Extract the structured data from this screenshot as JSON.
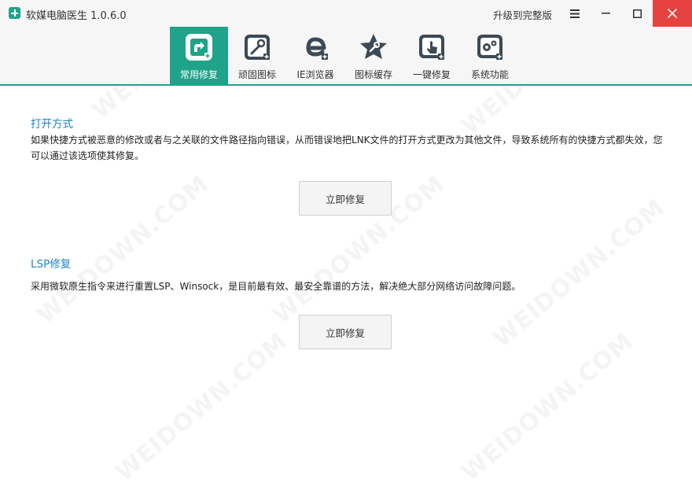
{
  "window": {
    "title": "软媒电脑医生 1.0.6.0",
    "upgrade_label": "升级到完整版"
  },
  "toolbar": {
    "tabs": [
      {
        "label": "常用修复",
        "icon": "common-repair-icon",
        "active": true
      },
      {
        "label": "顽固图标",
        "icon": "stubborn-icon-tools-icon",
        "active": false
      },
      {
        "label": "IE浏览器",
        "icon": "ie-browser-icon",
        "active": false
      },
      {
        "label": "图标缓存",
        "icon": "icon-cache-star-icon",
        "active": false
      },
      {
        "label": "一键修复",
        "icon": "one-click-repair-icon",
        "active": false
      },
      {
        "label": "系统功能",
        "icon": "system-functions-gear-icon",
        "active": false
      }
    ]
  },
  "sections": [
    {
      "title": "打开方式",
      "description": "如果快捷方式被恶意的修改或者与之关联的文件路径指向错误，从而错误地把LNK文件的打开方式更改为其他文件，导致系统所有的快捷方式都失效，您可以通过该选项使其修复。",
      "button_label": "立即修复"
    },
    {
      "title": "LSP修复",
      "description": "采用微软原生指令来进行重置LSP、Winsock，是目前最有效、最安全靠谱的方法，解决绝大部分网络访问故障问题。",
      "button_label": "立即修复"
    }
  ],
  "watermark": "WEIDOWN.COM",
  "colors": {
    "accent": "#1fa38a",
    "section_title": "#1a86c8",
    "close_button": "#e64340",
    "titlebar_bg": "#f6f6f6"
  }
}
